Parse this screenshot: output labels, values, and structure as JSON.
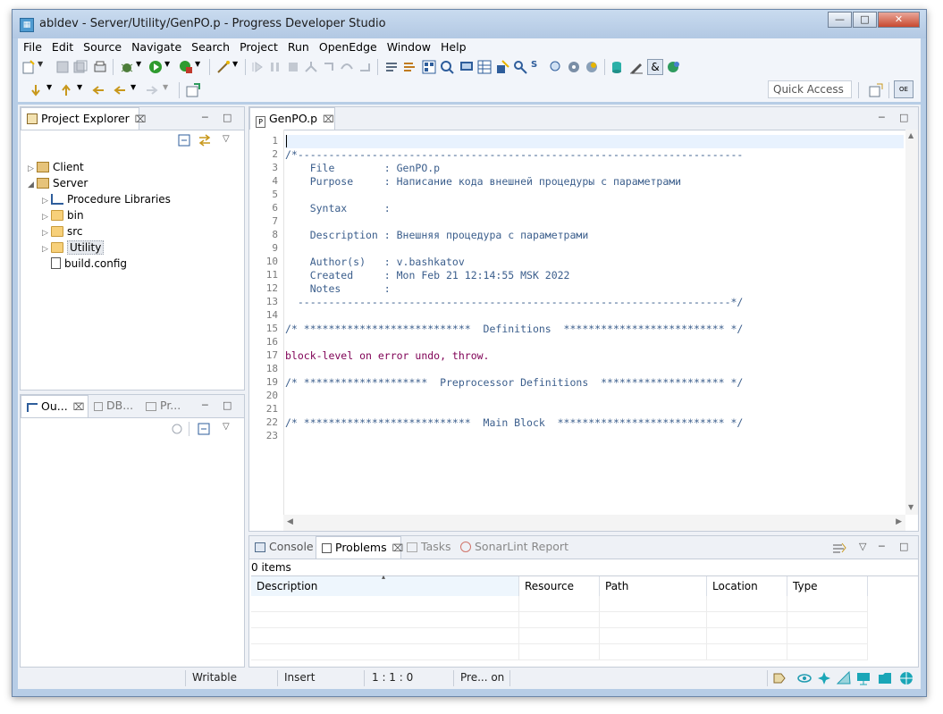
{
  "window": {
    "title": "abldev - Server/Utility/GenPO.p - Progress Developer Studio"
  },
  "menu": [
    "File",
    "Edit",
    "Source",
    "Navigate",
    "Search",
    "Project",
    "Run",
    "OpenEdge",
    "Window",
    "Help"
  ],
  "toolbar": {
    "quick_access_placeholder": "Quick Access"
  },
  "project_explorer": {
    "title": "Project Explorer",
    "tree": [
      {
        "label": "Client",
        "icon": "openedge-project-icon",
        "level": 0,
        "expanded": false
      },
      {
        "label": "Server",
        "icon": "openedge-project-icon",
        "level": 0,
        "expanded": true
      },
      {
        "label": "Procedure Libraries",
        "icon": "library-icon",
        "level": 1,
        "expanded": false
      },
      {
        "label": "bin",
        "icon": "folder-icon",
        "level": 1,
        "expanded": false
      },
      {
        "label": "src",
        "icon": "folder-icon",
        "level": 1,
        "expanded": false
      },
      {
        "label": "Utility",
        "icon": "folder-icon",
        "level": 1,
        "expanded": false,
        "selected": true
      },
      {
        "label": "build.config",
        "icon": "config-file-icon",
        "level": 1
      }
    ]
  },
  "outline_panel": {
    "tabs": [
      "Ou...",
      "DB...",
      "Pr..."
    ]
  },
  "editor": {
    "tab": "GenPO.p",
    "lines": [
      "",
      "/*------------------------------------------------------------------------",
      "    File        : GenPO.p",
      "    Purpose     : Написание кода внешней процедуры с параметрами",
      "",
      "    Syntax      :",
      "",
      "    Description : Внешняя процедура с параметрами",
      "",
      "    Author(s)   : v.bashkatov",
      "    Created     : Mon Feb 21 12:14:55 MSK 2022",
      "    Notes       :",
      "  ----------------------------------------------------------------------*/",
      "",
      "/* ***************************  Definitions  ************************** */",
      "",
      "block-level on error undo, throw.",
      "",
      "/* ********************  Preprocessor Definitions  ******************** */",
      "",
      "",
      "/* ***************************  Main Block  *************************** */",
      ""
    ],
    "line_numbers": [
      "1",
      "2",
      "3",
      "4",
      "5",
      "6",
      "7",
      "8",
      "9",
      "10",
      "11",
      "12",
      "13",
      "14",
      "15",
      "16",
      "17",
      "18",
      "19",
      "20",
      "21",
      "22",
      "23"
    ]
  },
  "bottom_panel": {
    "tabs": [
      "Console",
      "Problems",
      "Tasks",
      "SonarLint Report"
    ],
    "active_tab": "Problems",
    "items_count": "0 items",
    "columns": [
      "Description",
      "Resource",
      "Path",
      "Location",
      "Type"
    ]
  },
  "status": {
    "writable": "Writable",
    "insert": "Insert",
    "position": "1 : 1 : 0",
    "pre": "Pre... on"
  },
  "colors": {
    "accent": "#b7cde6",
    "keyword": "#7f0055",
    "comment": "#3f6fa0"
  }
}
